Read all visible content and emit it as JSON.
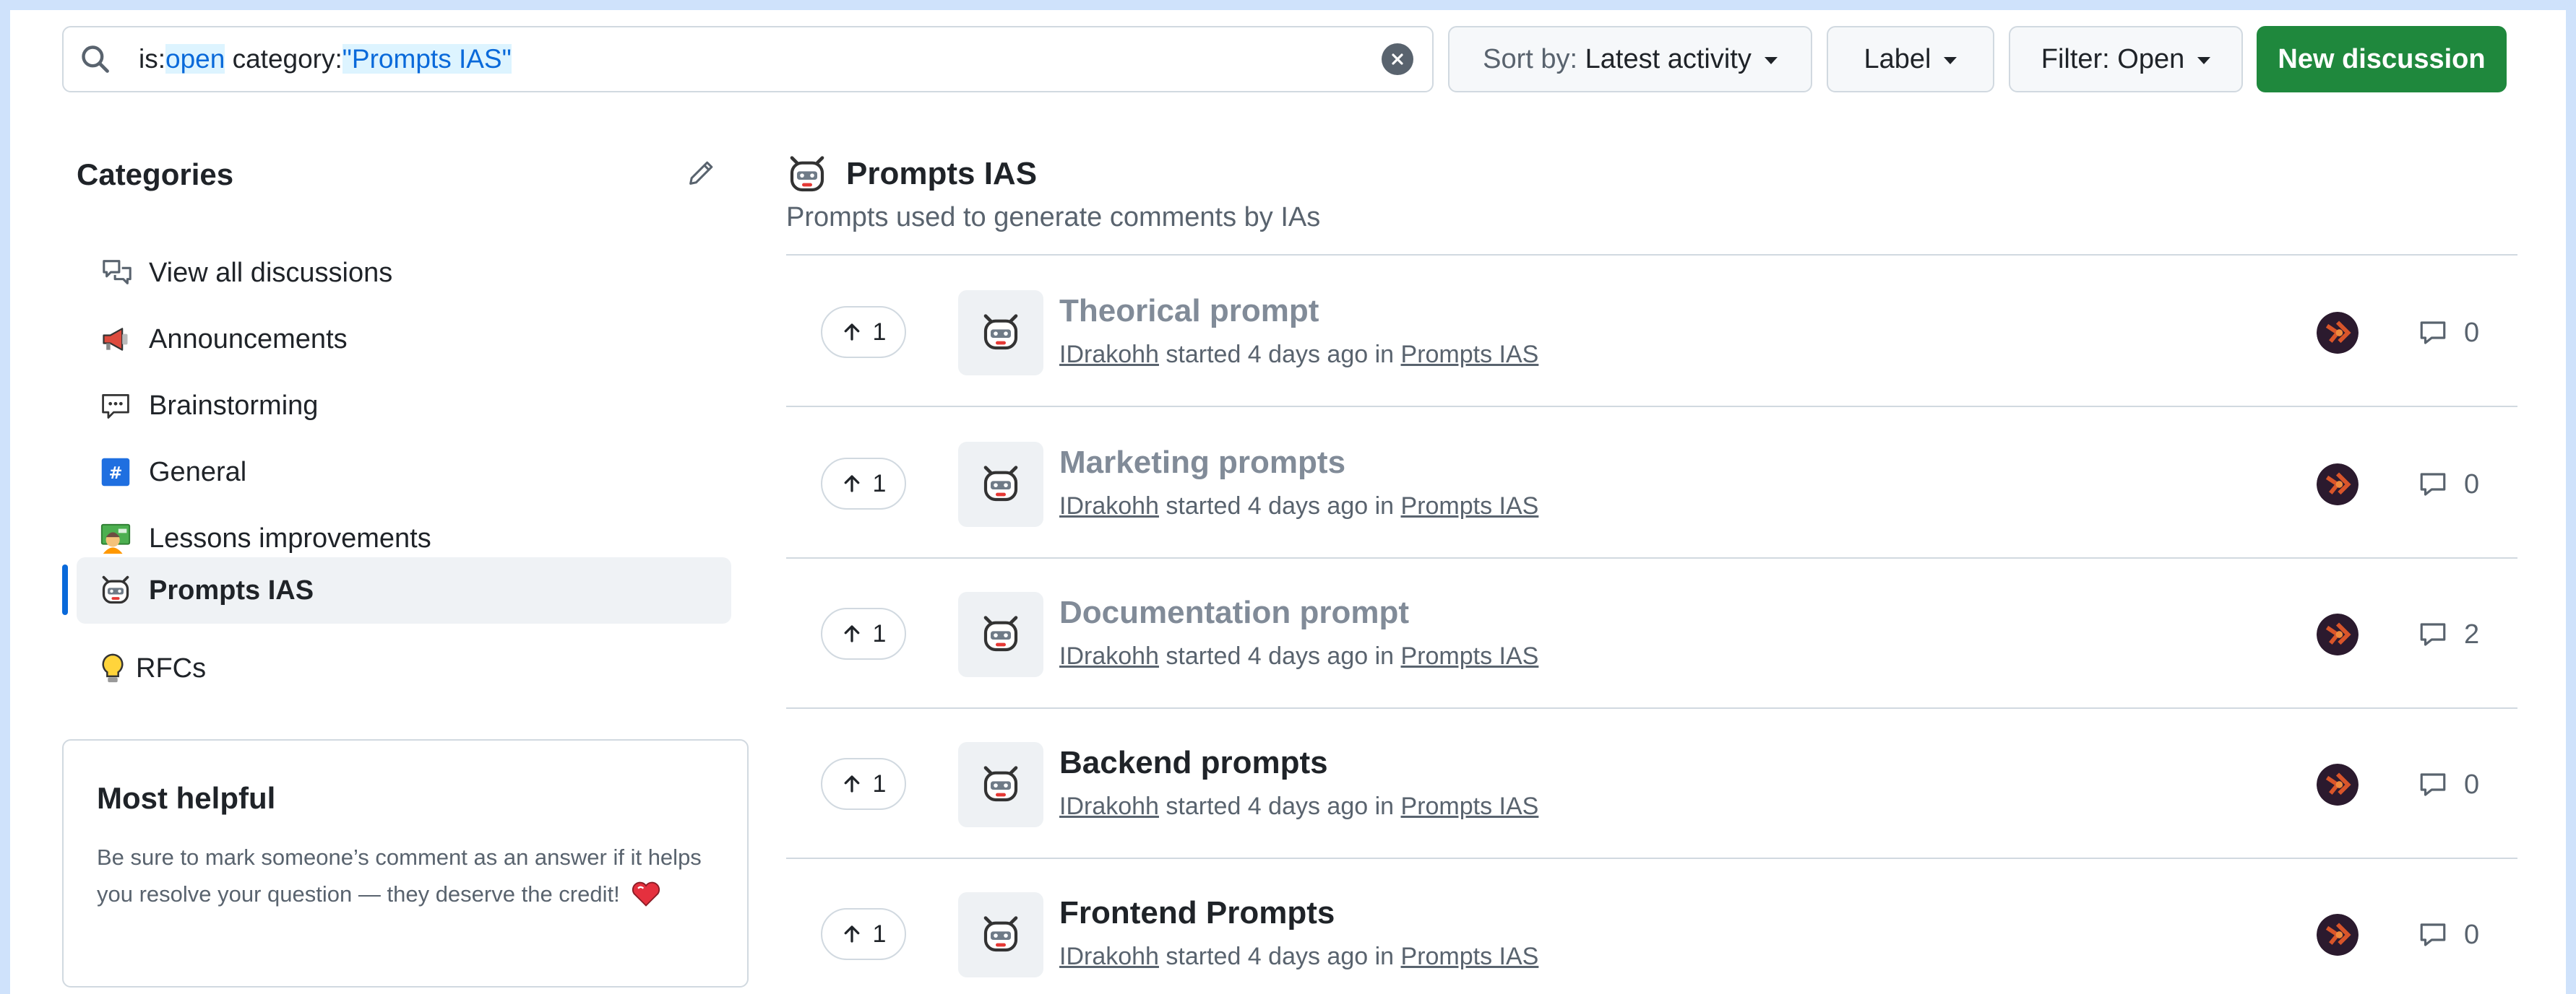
{
  "search": {
    "prefix_key": "is:",
    "prefix_value": "open",
    "category_key": " category:",
    "category_value": "\"Prompts IAS\""
  },
  "toolbar": {
    "sort_label": "Sort by:",
    "sort_value": "Latest activity",
    "label_button": "Label",
    "filter_button": "Filter: Open",
    "new_discussion": "New discussion"
  },
  "sidebar": {
    "title": "Categories",
    "items": [
      {
        "label": "View all discussions",
        "icon": "comment-discussion-icon"
      },
      {
        "label": "Announcements",
        "icon": "megaphone-icon"
      },
      {
        "label": "Brainstorming",
        "icon": "speech-balloon-icon"
      },
      {
        "label": "General",
        "icon": "hash-icon"
      },
      {
        "label": "Lessons improvements",
        "icon": "teacher-icon"
      },
      {
        "label": "Prompts IAS",
        "icon": "robot-icon",
        "active": true
      },
      {
        "label": "RFCs",
        "icon": "lightbulb-icon"
      }
    ]
  },
  "helpful": {
    "title": "Most helpful",
    "body": "Be sure to mark someone’s comment as an answer if it helps you resolve your question — they deserve the credit!",
    "icon": "heart-icon"
  },
  "category": {
    "title": "Prompts IAS",
    "description": "Prompts used to generate comments by IAs"
  },
  "discussions": [
    {
      "title": "Theorical prompt",
      "author": "IDrakohh",
      "started": " started 4 days ago in ",
      "category": "Prompts IAS",
      "upvotes": "1",
      "comments": "0"
    },
    {
      "title": "Marketing prompts",
      "author": "IDrakohh",
      "started": " started 4 days ago in ",
      "category": "Prompts IAS",
      "upvotes": "1",
      "comments": "0"
    },
    {
      "title": "Documentation prompt",
      "author": "IDrakohh",
      "started": " started 4 days ago in ",
      "category": "Prompts IAS",
      "upvotes": "1",
      "comments": "2"
    },
    {
      "title": "Backend prompts",
      "author": "IDrakohh",
      "started": " started 4 days ago in ",
      "category": "Prompts IAS",
      "upvotes": "1",
      "comments": "0"
    },
    {
      "title": "Frontend Prompts",
      "author": "IDrakohh",
      "started": " started 4 days ago in ",
      "category": "Prompts IAS",
      "upvotes": "1",
      "comments": "0"
    }
  ],
  "colors": {
    "primary_button": "#1f883d",
    "accent": "#0969da",
    "visited_title": "#818b98",
    "border": "#d1d9e0"
  }
}
